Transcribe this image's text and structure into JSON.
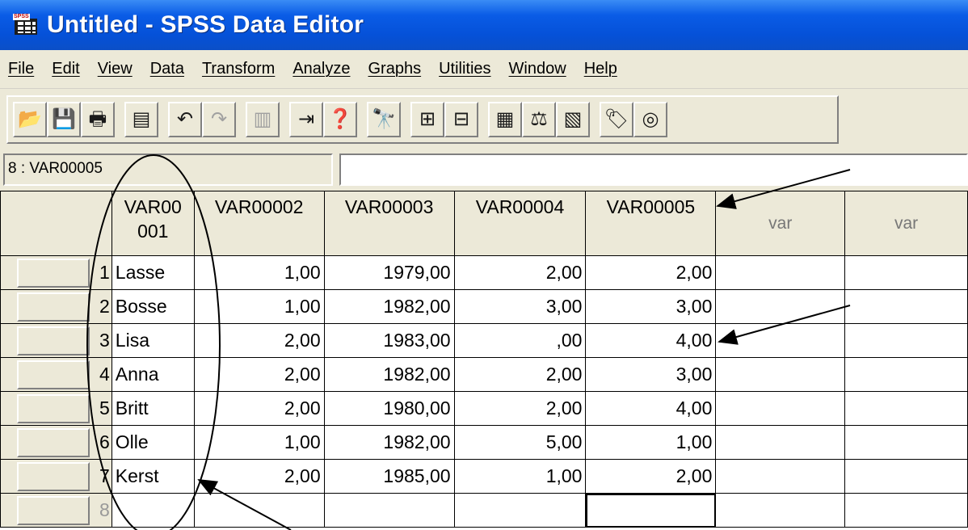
{
  "window": {
    "title": "Untitled - SPSS Data Editor",
    "icon": "spss-grid-icon",
    "icon_tag": "SPSS"
  },
  "menu": [
    "File",
    "Edit",
    "View",
    "Data",
    "Transform",
    "Analyze",
    "Graphs",
    "Utilities",
    "Window",
    "Help"
  ],
  "toolbar": {
    "buttons": [
      {
        "name": "open-icon",
        "glyph": "📂"
      },
      {
        "name": "save-icon",
        "glyph": "💾"
      },
      {
        "name": "print-icon",
        "glyph": "🖶"
      },
      {
        "name": "dialog-recall-icon",
        "glyph": "▤"
      },
      {
        "name": "undo-icon",
        "glyph": "↶"
      },
      {
        "name": "redo-icon",
        "glyph": "↷",
        "disabled": true
      },
      {
        "name": "goto-chart-icon",
        "glyph": "▥",
        "disabled": true
      },
      {
        "name": "goto-case-icon",
        "glyph": "⇥"
      },
      {
        "name": "variables-icon",
        "glyph": "❓"
      },
      {
        "name": "find-icon",
        "glyph": "🔭"
      },
      {
        "name": "insert-case-icon",
        "glyph": "⊞"
      },
      {
        "name": "insert-variable-icon",
        "glyph": "⊟"
      },
      {
        "name": "split-file-icon",
        "glyph": "▦"
      },
      {
        "name": "weight-cases-icon",
        "glyph": "⚖"
      },
      {
        "name": "select-cases-icon",
        "glyph": "▧"
      },
      {
        "name": "value-labels-icon",
        "glyph": "🏷"
      },
      {
        "name": "use-sets-icon",
        "glyph": "◎"
      }
    ]
  },
  "cellbar": {
    "reference": "8 : VAR00005",
    "value": ""
  },
  "sheet": {
    "columns": [
      "VAR00\n001",
      "VAR00002",
      "VAR00003",
      "VAR00004",
      "VAR00005",
      "var",
      "var"
    ],
    "rows": [
      {
        "n": "1",
        "cells": [
          "Lasse",
          "1,00",
          "1979,00",
          "2,00",
          "2,00",
          "",
          ""
        ]
      },
      {
        "n": "2",
        "cells": [
          "Bosse",
          "1,00",
          "1982,00",
          "3,00",
          "3,00",
          "",
          ""
        ]
      },
      {
        "n": "3",
        "cells": [
          "Lisa",
          "2,00",
          "1983,00",
          ",00",
          "4,00",
          "",
          ""
        ]
      },
      {
        "n": "4",
        "cells": [
          "Anna",
          "2,00",
          "1982,00",
          "2,00",
          "3,00",
          "",
          ""
        ]
      },
      {
        "n": "5",
        "cells": [
          "Britt",
          "2,00",
          "1980,00",
          "2,00",
          "4,00",
          "",
          ""
        ]
      },
      {
        "n": "6",
        "cells": [
          "Olle",
          "1,00",
          "1982,00",
          "5,00",
          "1,00",
          "",
          ""
        ]
      },
      {
        "n": "7",
        "cells": [
          "Kerst",
          "2,00",
          "1985,00",
          "1,00",
          "2,00",
          "",
          ""
        ]
      },
      {
        "n": "8",
        "cells": [
          "",
          "",
          "",
          "",
          "",
          "",
          ""
        ]
      }
    ]
  }
}
